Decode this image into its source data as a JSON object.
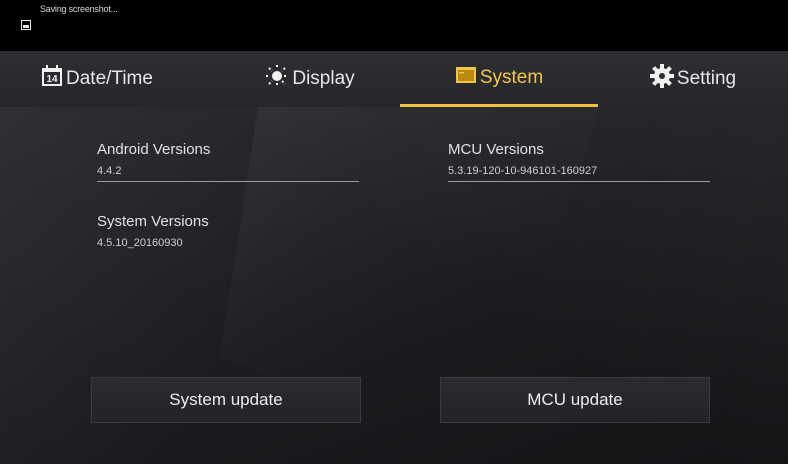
{
  "statusbar": {
    "notification": "Saving screenshot..."
  },
  "tabs": [
    {
      "label": "Date/Time",
      "icon": "calendar-icon",
      "icon_text": "14"
    },
    {
      "label": "Display",
      "icon": "sun-icon"
    },
    {
      "label": "System",
      "icon": "system-icon",
      "active": true
    },
    {
      "label": "Setting",
      "icon": "gear-icon"
    }
  ],
  "system_info": {
    "android": {
      "title": "Android Versions",
      "value": "4.4.2"
    },
    "mcu": {
      "title": "MCU Versions",
      "value": "5.3.19-120-10-946101-160927"
    },
    "system": {
      "title": "System Versions",
      "value": "4.5.10_20160930"
    }
  },
  "buttons": {
    "system_update": "System update",
    "mcu_update": "MCU update"
  },
  "colors": {
    "accent": "#f0c13a",
    "background": "#1a1b1e",
    "tabbar": "#2a2b2f"
  }
}
